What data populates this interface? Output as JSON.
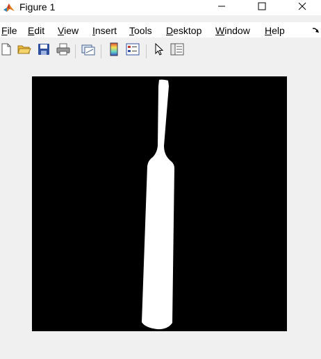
{
  "window": {
    "title": "Figure 1",
    "app_icon": "matlab-icon",
    "controls": [
      "minimize-icon",
      "maximize-icon",
      "close-icon"
    ]
  },
  "menu": {
    "items": [
      {
        "label_acc": "F",
        "label_rest": "ile"
      },
      {
        "label_acc": "E",
        "label_rest": "dit"
      },
      {
        "label_acc": "V",
        "label_rest": "iew"
      },
      {
        "label_acc": "I",
        "label_rest": "nsert"
      },
      {
        "label_acc": "T",
        "label_rest": "ools"
      },
      {
        "label_acc": "D",
        "label_rest": "esktop"
      },
      {
        "label_acc": "W",
        "label_rest": "indow"
      },
      {
        "label_acc": "H",
        "label_rest": "elp"
      }
    ],
    "overflow_icon": "dock-arrow-icon"
  },
  "toolbar": {
    "buttons": [
      "new-figure-icon",
      "open-file-icon",
      "save-icon",
      "print-icon",
      "link-plot-icon",
      "colorbar-icon",
      "legend-icon",
      "edit-plot-pointer-icon",
      "property-inspector-icon"
    ]
  },
  "figure": {
    "image_description_colors": {
      "background": "#000000",
      "foreground": "#ffffff"
    }
  }
}
